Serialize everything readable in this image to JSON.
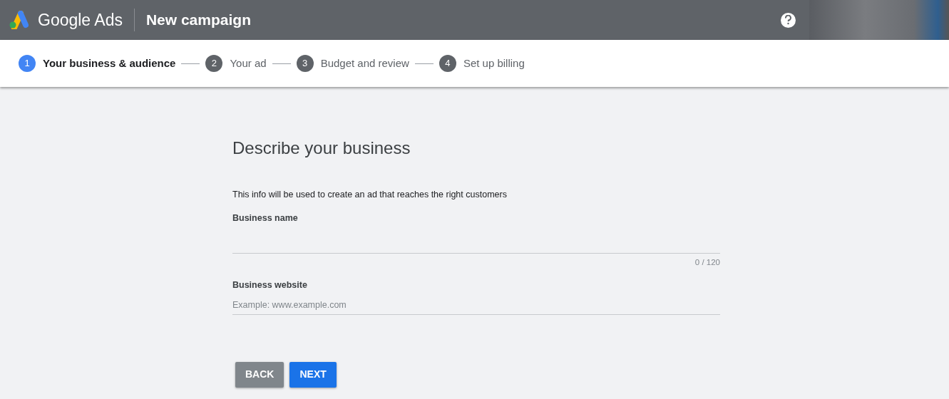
{
  "header": {
    "product": "Google Ads",
    "title": "New campaign"
  },
  "steps": [
    {
      "number": "1",
      "label": "Your business & audience",
      "selected": true
    },
    {
      "number": "2",
      "label": "Your ad",
      "selected": false
    },
    {
      "number": "3",
      "label": "Budget and review",
      "selected": false
    },
    {
      "number": "4",
      "label": "Set up billing",
      "selected": false
    }
  ],
  "form": {
    "heading": "Describe your business",
    "intro": "This info will be used to create an ad that reaches the right customers",
    "fields": [
      {
        "label": "Business name",
        "counter": "0 / 120"
      },
      {
        "label": "Business website",
        "placeholder": "Example: www.example.com"
      }
    ],
    "buttons": [
      {
        "label": "BACK",
        "kind": "secondary"
      },
      {
        "label": "NEXT",
        "kind": "primary"
      }
    ]
  }
}
